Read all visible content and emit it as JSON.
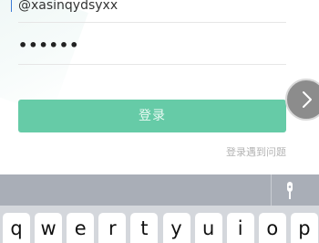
{
  "form": {
    "username_value": "@xasinqydsyxx",
    "password_masked": "••••••",
    "login_label": "登录",
    "help_link": "登录遇到问题"
  },
  "navigation": {
    "side_arrow_icon": "chevron-right-icon"
  },
  "keyboard": {
    "toolbar_icon": "microphone-icon",
    "row1": [
      "q",
      "w",
      "e",
      "r",
      "t",
      "y",
      "u",
      "i",
      "o",
      "p"
    ]
  },
  "colors": {
    "accent": "#66cba7",
    "keyboard_bg": "#d4d7dc",
    "keyboard_toolbar": "#a9aeb7"
  }
}
